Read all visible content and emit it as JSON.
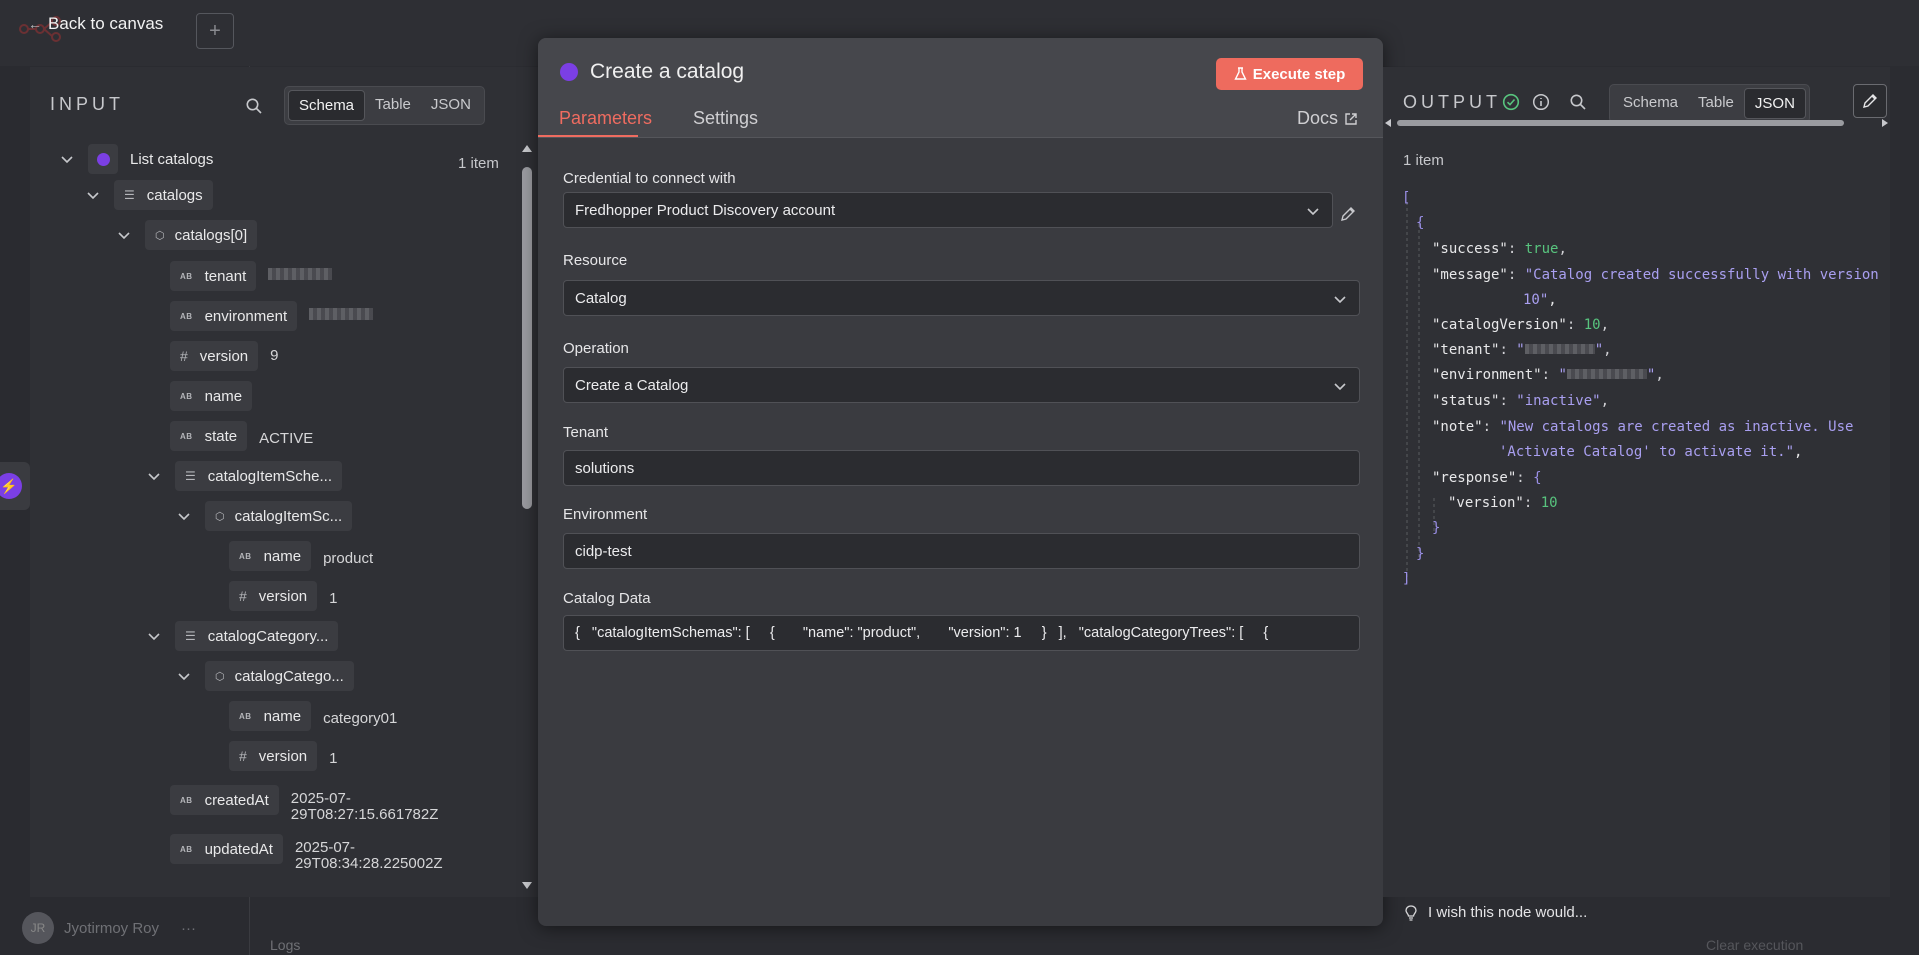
{
  "canvas": {
    "back_label": "Back to canvas",
    "add_symbol": "+",
    "user_initials": "JR",
    "user_name": "Jyotirmoy Roy",
    "logs_label": "Logs",
    "clear_label": "Clear execution"
  },
  "input": {
    "title": "INPUT",
    "tabs": [
      "Schema",
      "Table",
      "JSON"
    ],
    "active_tab": "Schema",
    "root_label": "List catalogs",
    "root_count": "1 item",
    "tree": {
      "catalogs": "catalogs",
      "catalogs0": "catalogs[0]",
      "tenant_key": "tenant",
      "environment_key": "environment",
      "version_key": "version",
      "version_val": "9",
      "name_key": "name",
      "state_key": "state",
      "state_val": "ACTIVE",
      "cis_key": "catalogItemSche...",
      "cis_item_key": "catalogItemSc...",
      "cis_name_key": "name",
      "cis_name_val": "product",
      "cis_version_key": "version",
      "cis_version_val": "1",
      "cct_key": "catalogCategory...",
      "cct_item_key": "catalogCatego...",
      "cct_name_key": "name",
      "cct_name_val": "category01",
      "cct_version_key": "version",
      "cct_version_val": "1",
      "created_key": "createdAt",
      "created_val": "2025-07-29T08:27:15.661782Z",
      "updated_key": "updatedAt",
      "updated_val": "2025-07-29T08:34:28.225002Z"
    }
  },
  "modal": {
    "title": "Create a catalog",
    "execute_label": "Execute step",
    "tabs": {
      "parameters": "Parameters",
      "settings": "Settings"
    },
    "docs_label": "Docs",
    "fields": {
      "credential_label": "Credential to connect with",
      "credential_value": "Fredhopper Product Discovery account",
      "resource_label": "Resource",
      "resource_value": "Catalog",
      "operation_label": "Operation",
      "operation_value": "Create a Catalog",
      "tenant_label": "Tenant",
      "tenant_value": "solutions",
      "environment_label": "Environment",
      "environment_value": "cidp-test",
      "catalog_data_label": "Catalog Data",
      "catalog_data_value": "{   \"catalogItemSchemas\": [     {       \"name\": \"product\",       \"version\": 1     }   ],   \"catalogCategoryTrees\": [     {"
    }
  },
  "output": {
    "title": "OUTPUT",
    "tabs": [
      "Schema",
      "Table",
      "JSON"
    ],
    "active_tab": "JSON",
    "items": "1 item",
    "json": {
      "open_bracket": "[",
      "open_brace": "{",
      "success_key": "\"success\"",
      "success_val": "true",
      "message_key": "\"message\"",
      "message_val1": "\"Catalog created successfully with version",
      "message_val2": "10\"",
      "catalogVersion_key": "\"catalogVersion\"",
      "catalogVersion_val": "10",
      "tenant_key": "\"tenant\"",
      "environment_key": "\"environment\"",
      "status_key": "\"status\"",
      "status_val": "\"inactive\"",
      "note_key": "\"note\"",
      "note_val1": "\"New catalogs are created as inactive. Use",
      "note_val2": "'Activate Catalog' to activate it.\"",
      "response_key": "\"response\"",
      "version_key": "\"version\"",
      "version_val": "10",
      "close_brace": "}",
      "close_bracket": "]"
    },
    "wish_label": "I wish this node would..."
  },
  "colors": {
    "accent": "#ee6b5e",
    "node_purple": "#7b3fe4",
    "success_green": "#58c47e",
    "string_purple": "#a99ff0"
  }
}
